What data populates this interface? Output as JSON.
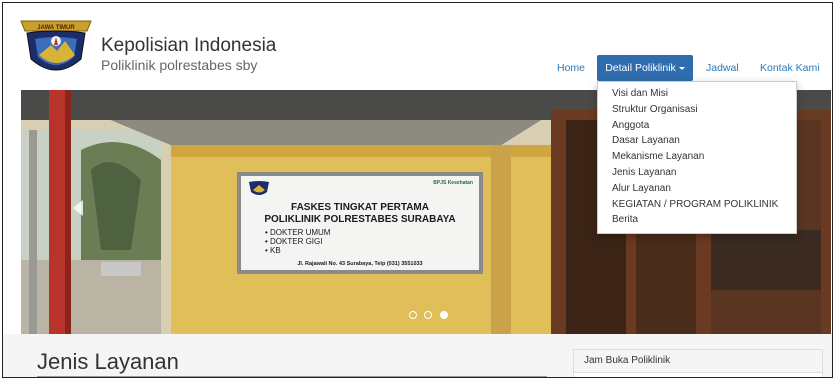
{
  "logo": {
    "banner_text": "JAWA TIMUR"
  },
  "brand": {
    "title": "Kepolisian Indonesia",
    "subtitle": "Poliklinik polrestabes sby"
  },
  "nav": {
    "home": "Home",
    "detail": "Detail Poliklinik",
    "jadwal": "Jadwal",
    "kontak": "Kontak Kami"
  },
  "dropdown": {
    "items": [
      "Visi dan Misi",
      "Struktur Organisasi",
      "Anggota",
      "Dasar Layanan",
      "Mekanisme Layanan",
      "Jenis Layanan",
      "Alur Layanan",
      "KEGIATAN / PROGRAM POLIKLINIK",
      "Berita"
    ]
  },
  "sign": {
    "line1": "FASKES TINGKAT PERTAMA",
    "line2": "POLIKLINIK POLRESTABES SURABAYA",
    "list": [
      "• DOKTER UMUM",
      "• DOKTER GIGI",
      "• KB"
    ],
    "address": "Jl. Rajawali No. 43 Surabaya, Telp (031) 3551033",
    "bpjs": "BPJS Kesehatan"
  },
  "carousel": {
    "slide_count": 3,
    "active_index": 2
  },
  "page": {
    "title": "Jenis Layanan"
  },
  "panel": {
    "title": "Jam Buka Poliklinik"
  },
  "colors": {
    "nav_active": "#2f6db0",
    "link": "#2a7ab8"
  }
}
